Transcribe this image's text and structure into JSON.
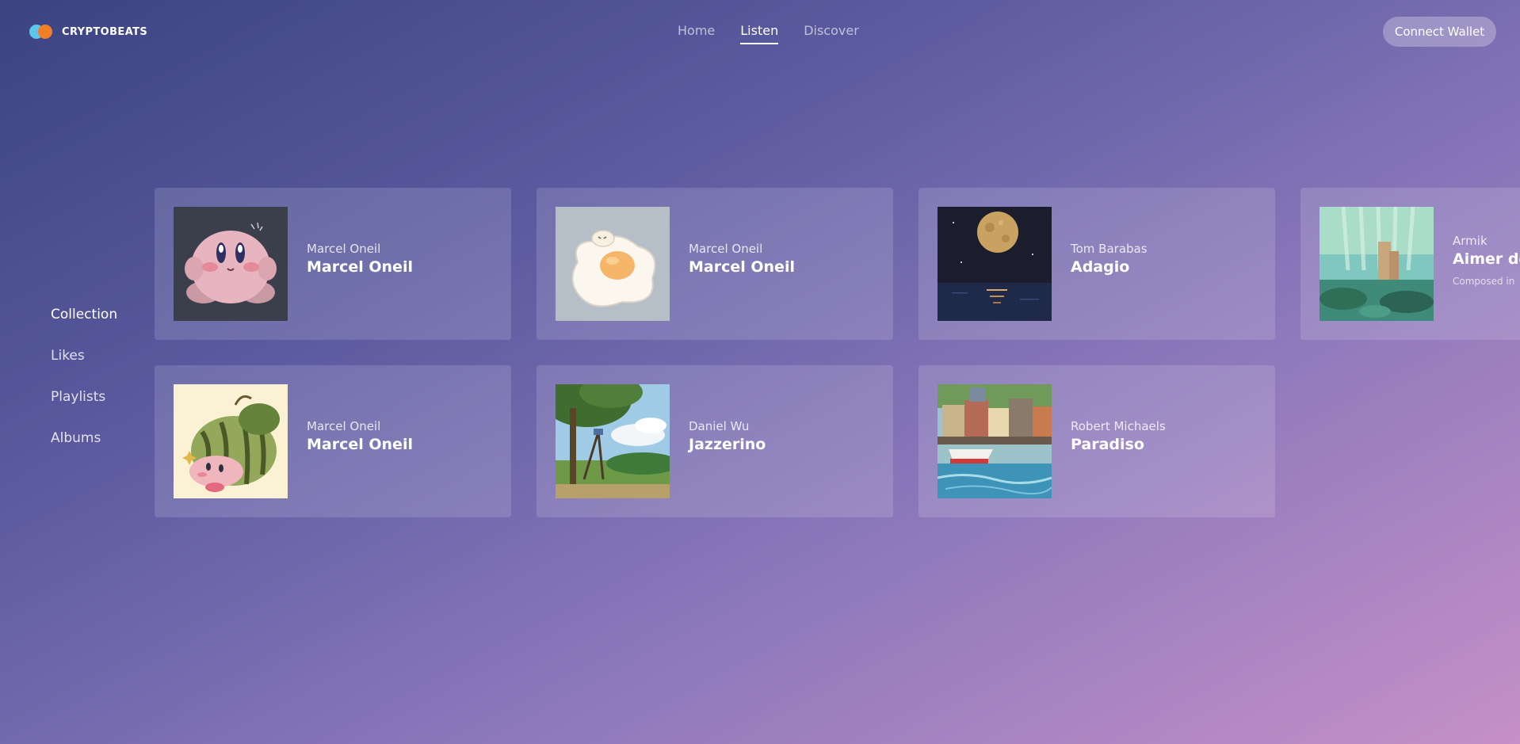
{
  "app": {
    "name": "CRYPTOBEATS"
  },
  "nav": {
    "items": [
      "Home",
      "Listen",
      "Discover"
    ],
    "active": "Listen"
  },
  "header": {
    "connect_wallet_label": "Connect Wallet"
  },
  "sidebar": {
    "items": [
      {
        "label": "Collection",
        "active": true
      },
      {
        "label": "Likes"
      },
      {
        "label": "Playlists"
      },
      {
        "label": "Albums"
      }
    ]
  },
  "cards": [
    {
      "artist": "Marcel Oneil",
      "title": "Marcel Oneil",
      "art": "pink-puffball-character"
    },
    {
      "artist": "Marcel Oneil",
      "title": "Marcel Oneil",
      "art": "fried-egg-character"
    },
    {
      "artist": "Tom Barabas",
      "title": "Adagio",
      "art": "moon-over-ocean"
    },
    {
      "artist": "Armik",
      "title": "Aimer de",
      "subtitle": "Composed in",
      "art": "underwater-ruins"
    },
    {
      "artist": "Marcel Oneil",
      "title": "Marcel Oneil",
      "art": "puffball-with-melon"
    },
    {
      "artist": "Daniel Wu",
      "title": "Jazzerino",
      "art": "summer-tree-landscape"
    },
    {
      "artist": "Robert Michaels",
      "title": "Paradiso",
      "art": "harbor-town"
    }
  ]
}
